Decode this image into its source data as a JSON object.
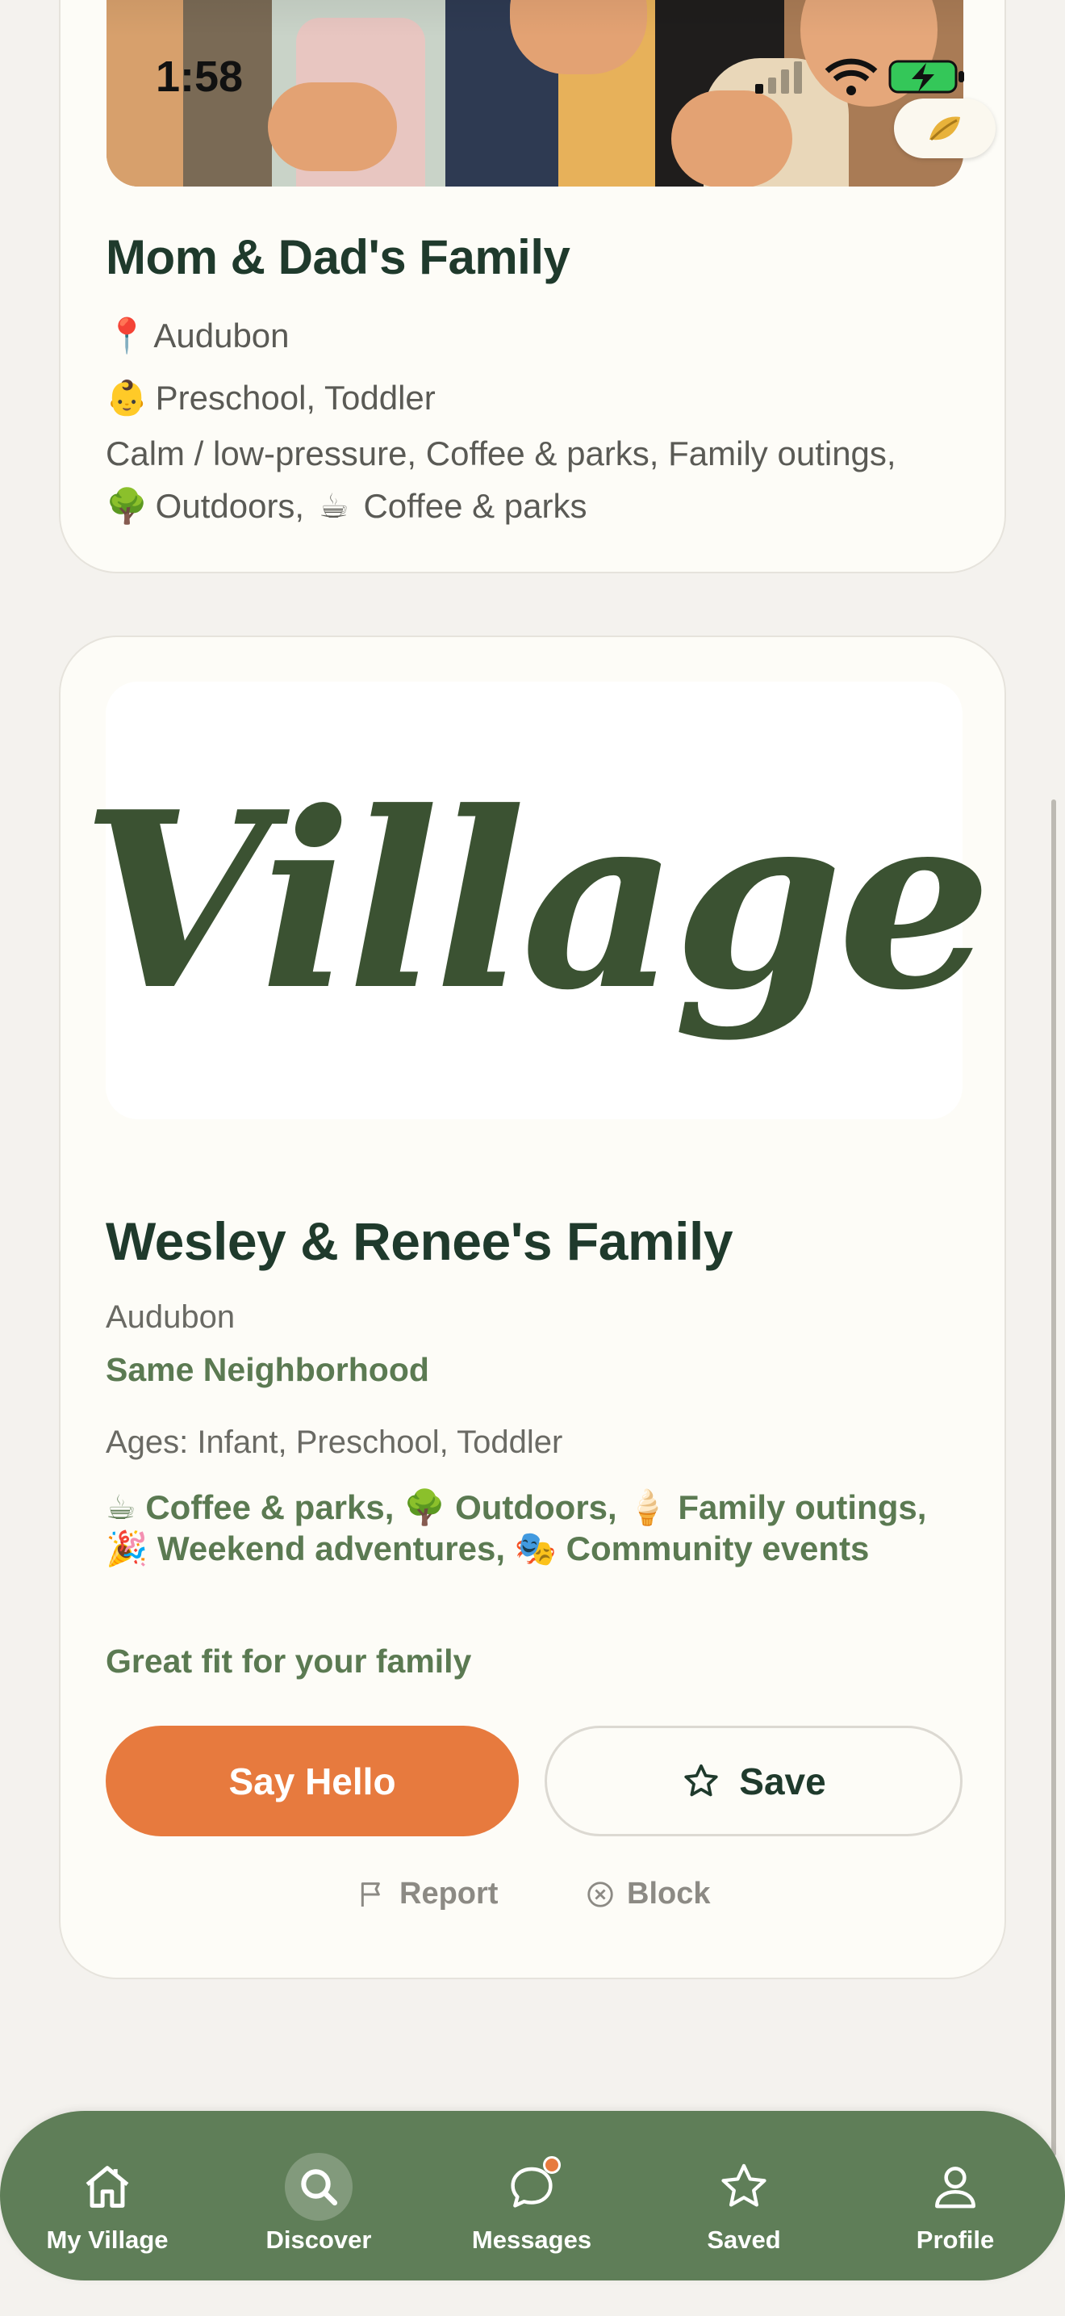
{
  "status_bar": {
    "time": "1:58"
  },
  "card_previous": {
    "title": "Mom & Dad's Family",
    "location_icon": "📍",
    "location": "Audubon",
    "ages_icon": "👶",
    "ages": "Preschool, Toddler",
    "tags_text_1": "Calm / low-pressure, Coffee & parks, Family outings,",
    "tags_icon_outdoors": "🌳",
    "tags_text_2": "Outdoors,",
    "tags_icon_coffee": "☕",
    "tags_text_3": "Coffee & parks"
  },
  "card_current": {
    "logo_text": "Village",
    "title": "Wesley & Renee's Family",
    "location": "Audubon",
    "neighborhood_badge": "Same Neighborhood",
    "ages": "Ages: Infant, Preschool, Toddler",
    "tags": [
      {
        "icon": "☕",
        "label": "Coffee & parks,"
      },
      {
        "icon": "🌳",
        "label": "Outdoors,"
      },
      {
        "icon": "🍦",
        "label": "Family outings,"
      },
      {
        "icon": "🎉",
        "label": "Weekend adventures,"
      },
      {
        "icon": "🎭",
        "label": "Community events"
      }
    ],
    "fit_text": "Great fit for your family",
    "say_hello_label": "Say Hello",
    "save_label": "Save",
    "report_label": "Report",
    "block_label": "Block"
  },
  "tabbar": {
    "tabs": [
      {
        "label": "My Village",
        "icon": "home-icon"
      },
      {
        "label": "Discover",
        "icon": "search-icon",
        "active": true
      },
      {
        "label": "Messages",
        "icon": "chat-bubble-icon",
        "badge": true
      },
      {
        "label": "Saved",
        "icon": "star-icon"
      },
      {
        "label": "Profile",
        "icon": "person-icon"
      }
    ]
  },
  "colors": {
    "background": "#f4f2ee",
    "card": "#fdfcf7",
    "title_green": "#1f3a2c",
    "accent_green": "#5b7a52",
    "tabbar_green": "#5f7e58",
    "primary_orange": "#e77a3e"
  }
}
